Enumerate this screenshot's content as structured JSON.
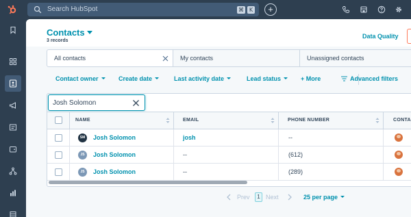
{
  "topbar": {
    "search_placeholder": "Search HubSpot",
    "shortcut_keys": [
      "⌘",
      "K"
    ],
    "add_label": "+"
  },
  "header": {
    "title": "Contacts",
    "record_count": "3 records",
    "data_quality": "Data Quality"
  },
  "views": [
    {
      "label": "All contacts"
    },
    {
      "label": "My contacts"
    },
    {
      "label": "Unassigned contacts"
    }
  ],
  "filters": {
    "contact_owner": "Contact owner",
    "create_date": "Create date",
    "last_activity_date": "Last activity date",
    "lead_status": "Lead status",
    "more": "+ More",
    "advanced": "Advanced filters"
  },
  "table": {
    "search_value": "Josh Solomon",
    "columns": {
      "name": "NAME",
      "email": "EMAIL",
      "phone": "PHONE NUMBER",
      "owner": "CONTA"
    },
    "rows": [
      {
        "avatar": "SM",
        "name": "Josh Solomon",
        "email": "josh",
        "phone": "--"
      },
      {
        "avatar": "JS",
        "name": "Josh Solomon",
        "email": "--",
        "phone": "(612)"
      },
      {
        "avatar": "JS",
        "name": "Josh Solomon",
        "email": "--",
        "phone": "(289)"
      }
    ]
  },
  "pagination": {
    "prev": "Prev",
    "current_page": "1",
    "next": "Next",
    "per_page": "25 per page"
  },
  "colors": {
    "nav_bg": "#2e3f50",
    "link": "#0091ae",
    "brand_orange": "#ff7a59"
  }
}
